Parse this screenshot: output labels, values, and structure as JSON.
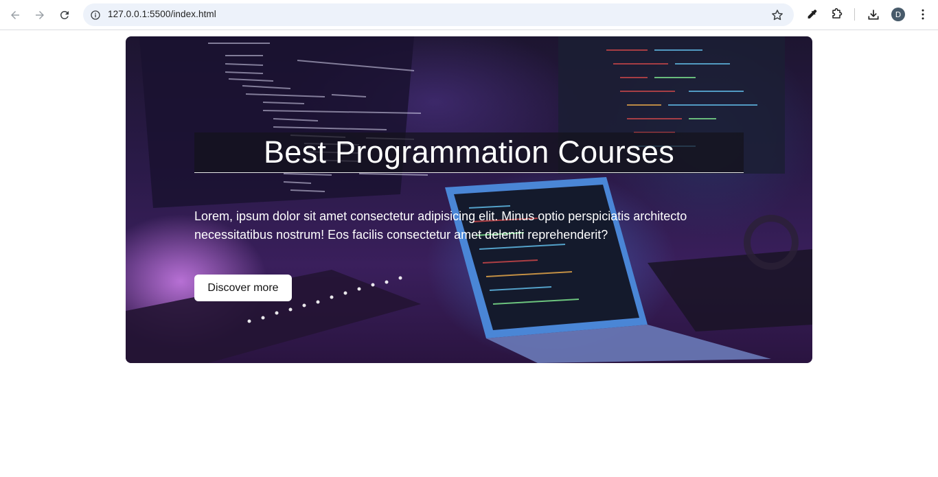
{
  "browser": {
    "url": "127.0.0.1:5500/index.html",
    "profile_initial": "D",
    "icons": {
      "back": "arrow-left-icon",
      "forward": "arrow-right-icon",
      "reload": "reload-icon",
      "site_info": "info-icon",
      "bookmark": "star-icon",
      "eyedropper": "eyedropper-icon",
      "extensions": "puzzle-icon",
      "downloads": "download-icon",
      "menu": "kebab-menu-icon"
    }
  },
  "hero": {
    "title": "Best Programmation Courses",
    "text": "Lorem, ipsum dolor sit amet consectetur adipisicing elit. Minus optio perspiciatis architecto necessitatibus nostrum! Eos facilis consectetur amet deleniti reprehenderit?",
    "button_label": "Discover more"
  },
  "colors": {
    "accent_purple": "#6a3aa8",
    "toolbar_bg": "#ffffff",
    "omnibox_bg": "#edf2fa",
    "button_bg": "#ffffff"
  }
}
